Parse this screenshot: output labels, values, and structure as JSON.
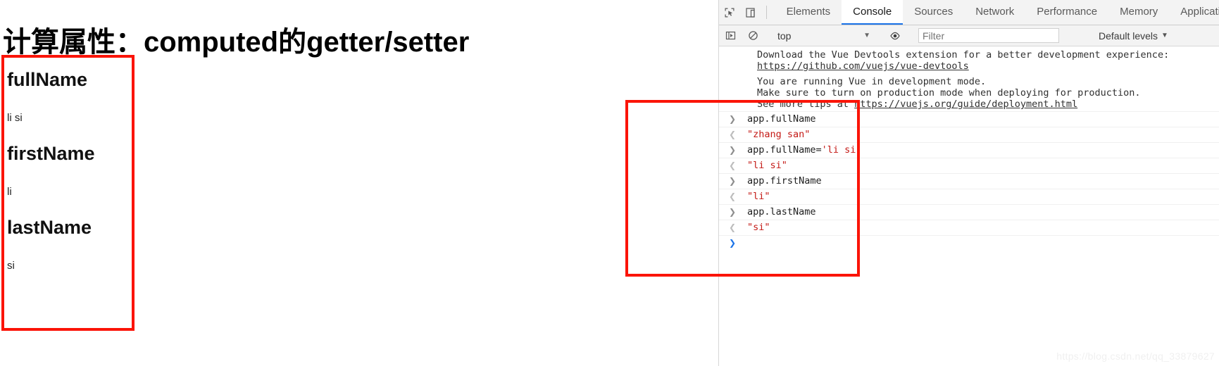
{
  "page": {
    "title_cn": "计算属性：",
    "title_en": "computed的getter/setter",
    "properties": [
      {
        "name": "fullName",
        "value": "li si"
      },
      {
        "name": "firstName",
        "value": "li"
      },
      {
        "name": "lastName",
        "value": "si"
      }
    ]
  },
  "devtools": {
    "icons": {
      "inspect": "inspect-element-icon",
      "device": "device-toolbar-icon",
      "sidebar": "console-sidebar-icon",
      "clear": "clear-console-icon",
      "eye": "live-expression-eye-icon"
    },
    "tabs": [
      {
        "label": "Elements",
        "active": false
      },
      {
        "label": "Console",
        "active": true
      },
      {
        "label": "Sources",
        "active": false
      },
      {
        "label": "Network",
        "active": false
      },
      {
        "label": "Performance",
        "active": false
      },
      {
        "label": "Memory",
        "active": false
      },
      {
        "label": "Application",
        "active": false
      }
    ],
    "context": "top",
    "filter_placeholder": "Filter",
    "filter_value": "",
    "levels": "Default levels",
    "caret": "▼",
    "messages": [
      {
        "id": "vue-msg-1",
        "line1": "Download the Vue Devtools extension for a better development experience:",
        "link": "https://github.com/vuejs/vue-devtools"
      },
      {
        "id": "vue-msg-2",
        "line1": "You are running Vue in development mode.",
        "line2": "Make sure to turn on production mode when deploying for production.",
        "line3_prefix": "See more tips at ",
        "link": "https://vuejs.org/guide/deployment.html"
      }
    ],
    "logs": [
      {
        "kind": "input",
        "arrow": "❯",
        "text": "app.fullName",
        "str": ""
      },
      {
        "kind": "output",
        "arrow": "❮",
        "text": "\"zhang san\"",
        "str": ""
      },
      {
        "kind": "input",
        "arrow": "❯",
        "text": "app.fullName=",
        "str": "'li si'"
      },
      {
        "kind": "output",
        "arrow": "❮",
        "text": "\"li si\"",
        "str": ""
      },
      {
        "kind": "input",
        "arrow": "❯",
        "text": "app.firstName",
        "str": ""
      },
      {
        "kind": "output",
        "arrow": "❮",
        "text": "\"li\"",
        "str": ""
      },
      {
        "kind": "input",
        "arrow": "❯",
        "text": "app.lastName",
        "str": ""
      },
      {
        "kind": "output",
        "arrow": "❮",
        "text": "\"si\"",
        "str": ""
      },
      {
        "kind": "prompt",
        "arrow": "❯",
        "text": "",
        "str": ""
      }
    ]
  },
  "watermark": "https://blog.csdn.net/qq_33879627",
  "colors": {
    "annotation_red": "#fb1408",
    "string_red": "#c41a16",
    "active_tab_underline": "#1a73e8",
    "toolbar_bg": "#f3f3f3"
  }
}
